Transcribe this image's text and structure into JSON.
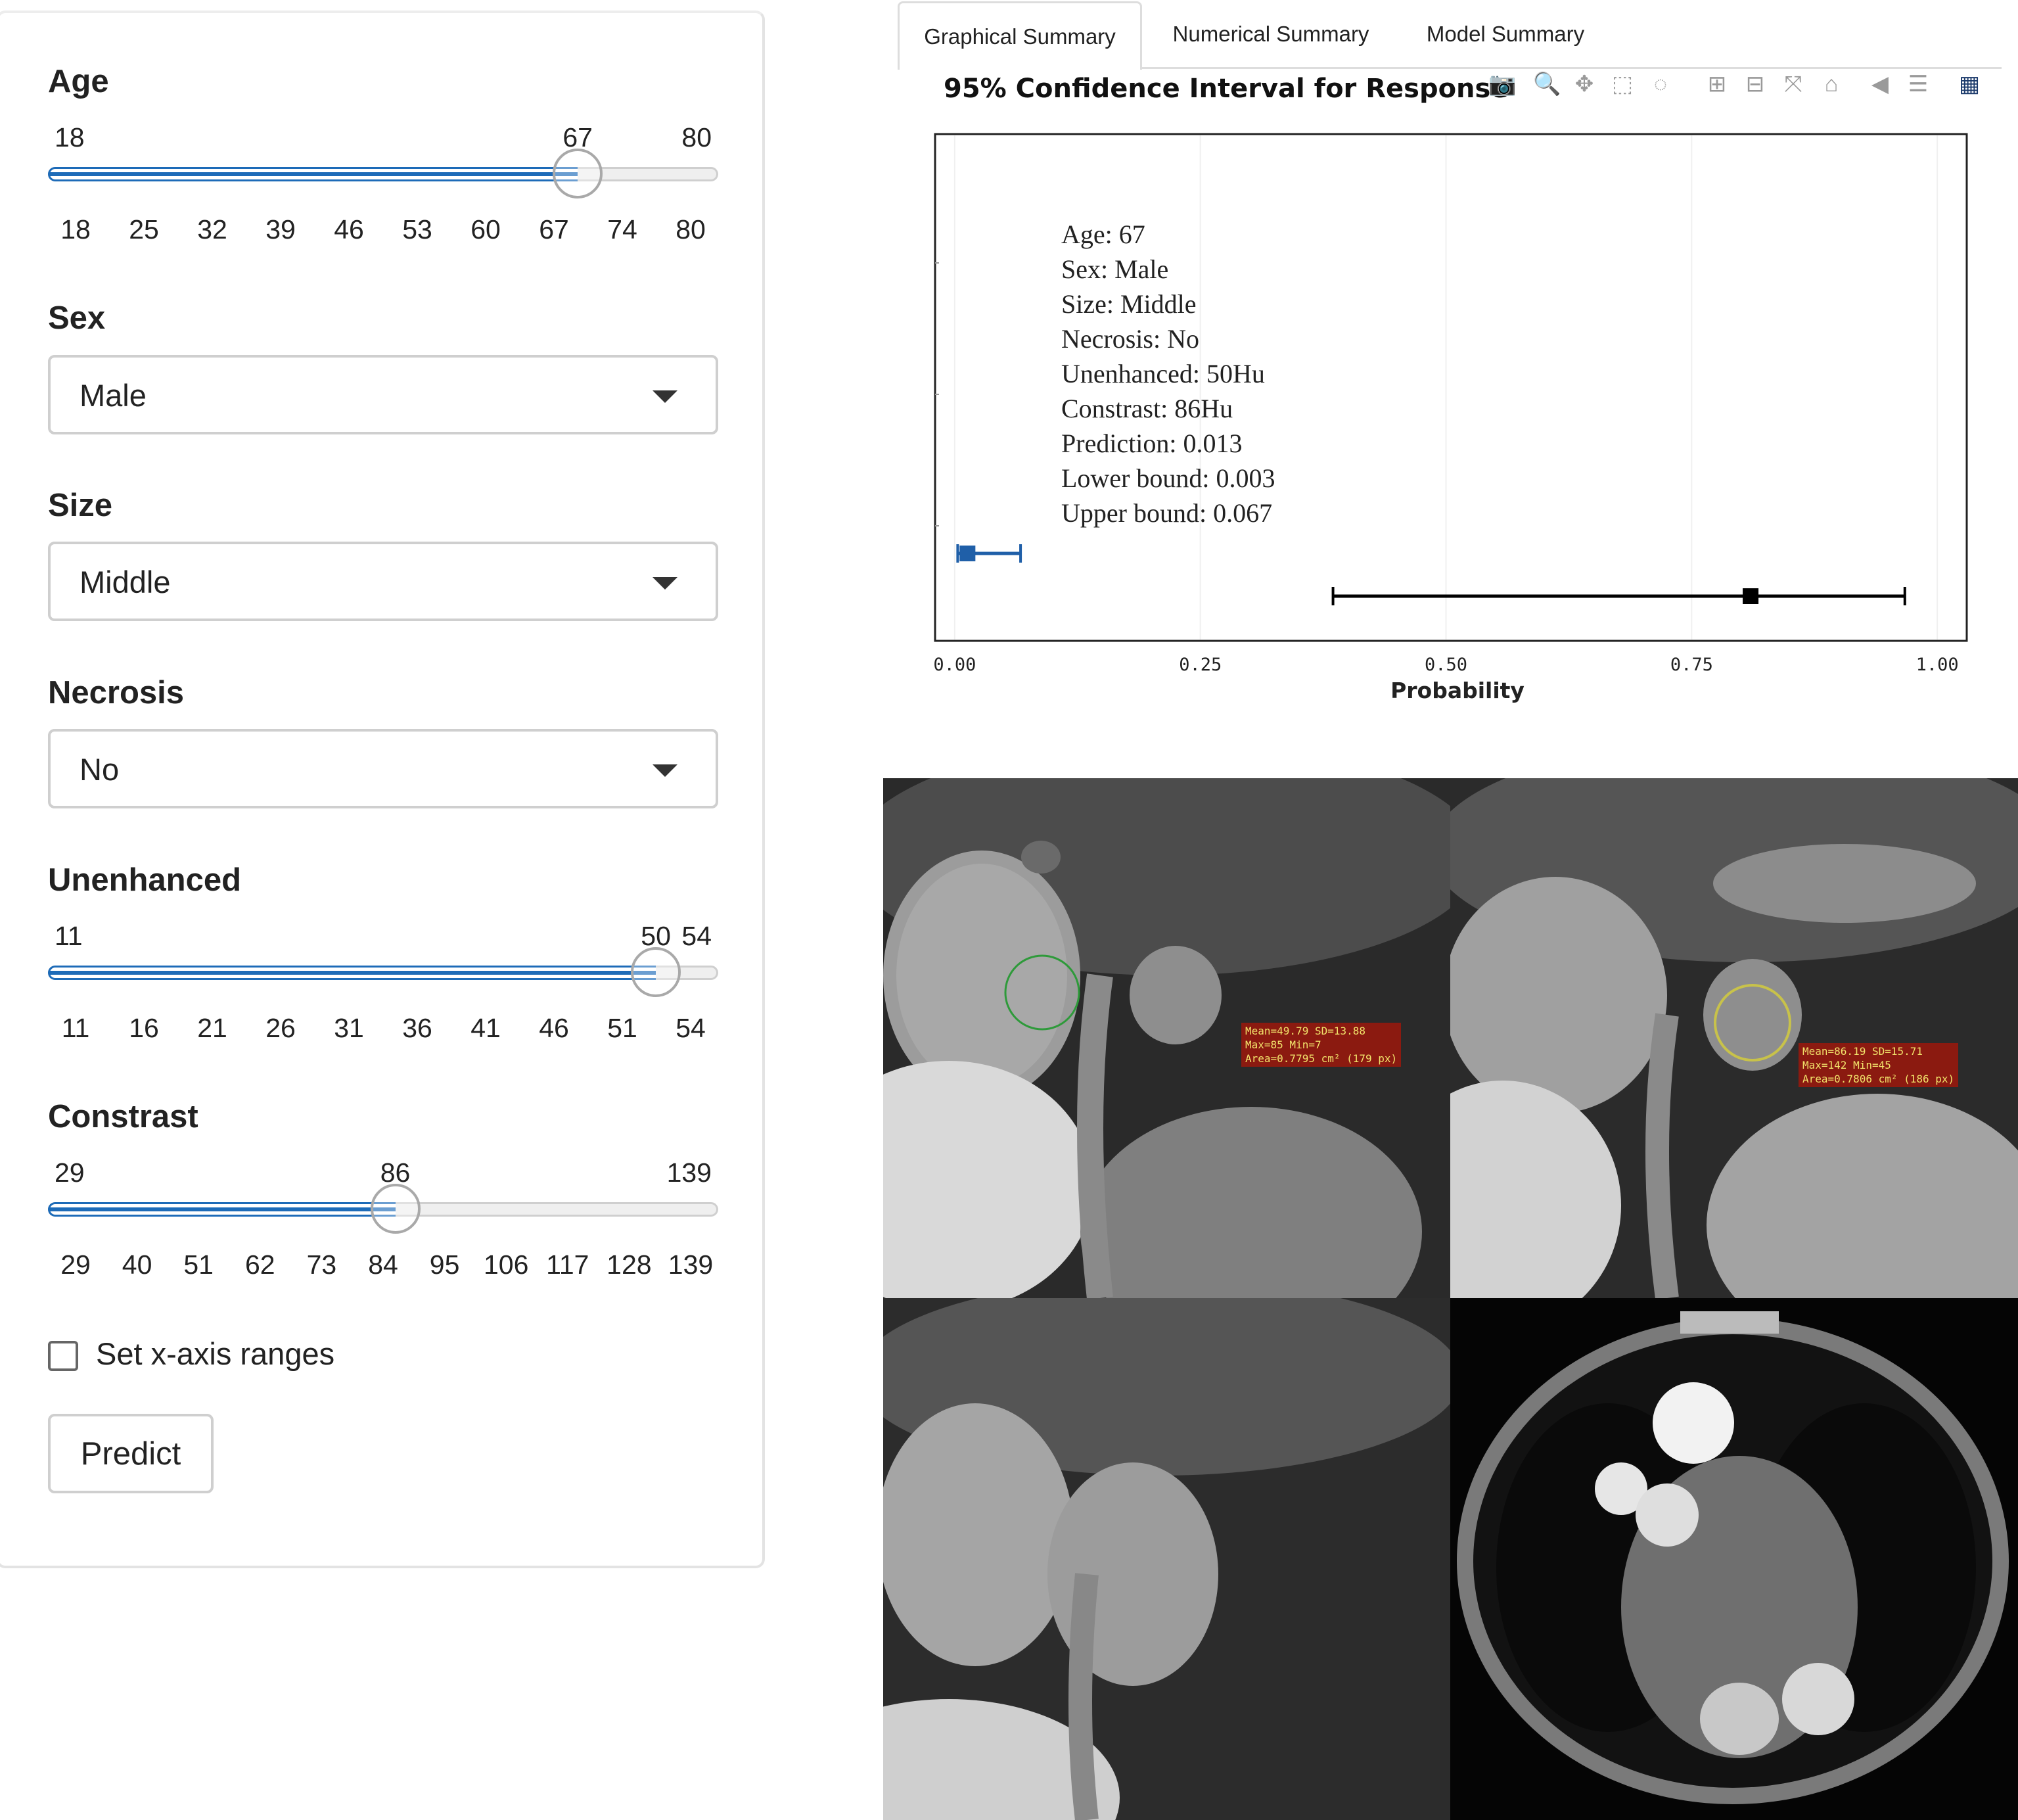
{
  "controls": {
    "age": {
      "label": "Age",
      "min": "18",
      "max": "80",
      "value": "67",
      "value_num": 67,
      "min_num": 18,
      "max_num": 80,
      "ticks": [
        "18",
        "25",
        "32",
        "39",
        "46",
        "53",
        "60",
        "67",
        "74",
        "80"
      ]
    },
    "sex": {
      "label": "Sex",
      "value": "Male"
    },
    "size": {
      "label": "Size",
      "value": "Middle"
    },
    "necrosis": {
      "label": "Necrosis",
      "value": "No"
    },
    "unenhanced": {
      "label": "Unenhanced",
      "min": "11",
      "max": "54",
      "value": "50",
      "value_num": 50,
      "min_num": 11,
      "max_num": 54,
      "ticks": [
        "11",
        "16",
        "21",
        "26",
        "31",
        "36",
        "41",
        "46",
        "51",
        "54"
      ]
    },
    "constrast": {
      "label": "Constrast",
      "min": "29",
      "max": "139",
      "value": "86",
      "value_num": 86,
      "min_num": 29,
      "max_num": 139,
      "ticks": [
        "29",
        "40",
        "51",
        "62",
        "73",
        "84",
        "95",
        "106",
        "117",
        "128",
        "139"
      ]
    },
    "set_xaxis_label": "Set x-axis ranges",
    "set_xaxis_checked": false,
    "predict_label": "Predict"
  },
  "tabs": [
    "Graphical Summary",
    "Numerical Summary",
    "Model Summary"
  ],
  "active_tab": "Graphical Summary",
  "chart_data": {
    "type": "scatter",
    "title": "95% Confidence Interval for Response",
    "xlabel": "Probability",
    "ylabel": "",
    "xlim": [
      -0.02,
      1.03
    ],
    "xticks": [
      "0.00",
      "0.25",
      "0.50",
      "0.75",
      "1.00"
    ],
    "series": [
      {
        "point": 0.013,
        "lower": 0.003,
        "upper": 0.067,
        "color": "#1f5fa8"
      },
      {
        "point": 0.81,
        "lower": 0.385,
        "upper": 0.967,
        "color": "#000000"
      }
    ],
    "annotation": [
      "Age: 67",
      "Sex: Male",
      "Size: Middle",
      "Necrosis: No",
      "Unenhanced: 50Hu",
      "Constrast: 86Hu",
      "Prediction: 0.013",
      "Lower bound: 0.003",
      "Upper bound: 0.067"
    ]
  },
  "modebar_icons": [
    "camera-icon",
    "zoom-icon",
    "pan-icon",
    "box-select-icon",
    "lasso-icon",
    "zoom-in-icon",
    "zoom-out-icon",
    "autoscale-icon",
    "home-icon",
    "spike-icon",
    "compare-icon",
    "plotly-logo-icon"
  ],
  "ct_images": {
    "roi1": [
      "Mean=49.79 SD=13.88",
      "Max=85 Min=7",
      "Area=0.7795 cm² (179 px)"
    ],
    "roi2": [
      "Mean=86.19 SD=15.71",
      "Max=142 Min=45",
      "Area=0.7806 cm² (186 px)"
    ]
  },
  "colors": {
    "accent": "#1d6bb8",
    "roi_green": "#2e9a3a",
    "roi_yellow": "#c8c24a",
    "roi_label_bg": "#8b1a10",
    "roi_label_text": "#f2e36b"
  }
}
